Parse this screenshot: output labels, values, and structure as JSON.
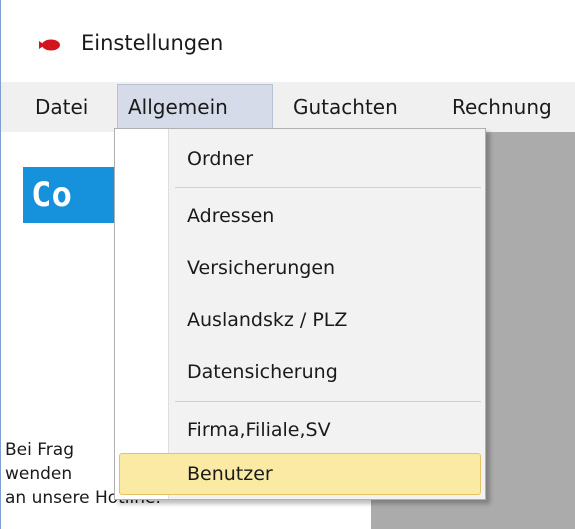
{
  "window": {
    "title": "Einstellungen",
    "icon": "red-app-icon"
  },
  "menubar": {
    "items": [
      {
        "label": "Datei"
      },
      {
        "label": "Allgemein"
      },
      {
        "label": "Gutachten"
      },
      {
        "label": "Rechnung"
      }
    ]
  },
  "dropdown": {
    "items": [
      {
        "label": "Ordner"
      },
      {
        "label": "Adressen"
      },
      {
        "label": "Versicherungen"
      },
      {
        "label": "Auslandskz / PLZ"
      },
      {
        "label": "Datensicherung"
      },
      {
        "label": "Firma,Filiale,SV"
      },
      {
        "label": "Benutzer"
      }
    ],
    "highlighted": "Benutzer"
  },
  "leftpanel": {
    "logo_text": "Co",
    "hotline_lines": [
      "Bei Frag",
      "wenden",
      "an unsere Hotline."
    ]
  },
  "colors": {
    "logo_bg": "#1592db",
    "highlight_bg": "#fbeaa3",
    "menu_active_bg": "#d5dbe8",
    "gray_area": "#ababab"
  }
}
